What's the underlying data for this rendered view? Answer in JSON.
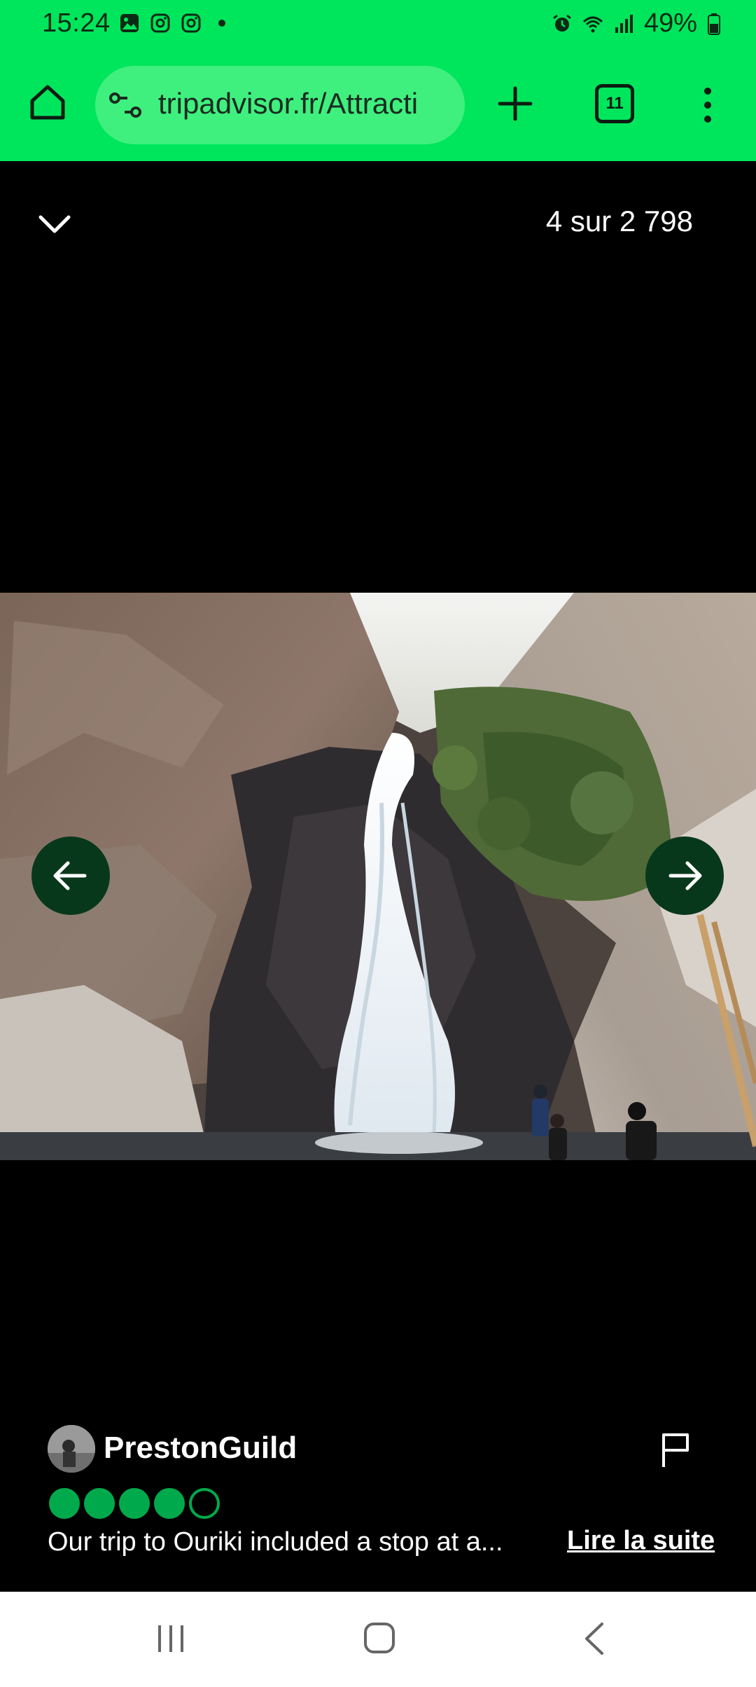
{
  "status_bar": {
    "time": "15:24",
    "battery": "49%",
    "left_icons": [
      "gallery-icon",
      "instagram-icon",
      "instagram-icon",
      "dot-icon"
    ],
    "right_icons": [
      "alarm-icon",
      "wifi-icon",
      "signal-icon",
      "battery-icon"
    ]
  },
  "browser": {
    "url": "tripadvisor.fr/Attracti",
    "tab_count": "11",
    "theme_color": "#00e65c"
  },
  "viewer": {
    "counter": "4 sur 2 798"
  },
  "review": {
    "username": "PrestonGuild",
    "rating": 4,
    "rating_max": 5,
    "snippet": "Our trip to Ouriki included a stop at a...",
    "read_more": "Lire la suite",
    "brand_color": "#00aa4c"
  }
}
